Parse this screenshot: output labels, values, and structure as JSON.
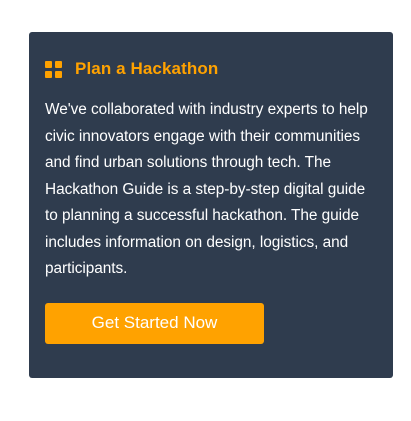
{
  "colors": {
    "accent": "#ffa200",
    "card_background": "#2f3c4e",
    "text": "#ffffff"
  },
  "card": {
    "icon": "grid-icon",
    "title": "Plan a Hackathon",
    "body": "We've collaborated with industry experts to help civic innovators engage with their communities and find urban solutions through tech. The Hackathon Guide is a step-by-step digital guide to planning a successful hackathon. The guide includes information on design, logistics, and participants.",
    "button_label": "Get Started Now"
  }
}
